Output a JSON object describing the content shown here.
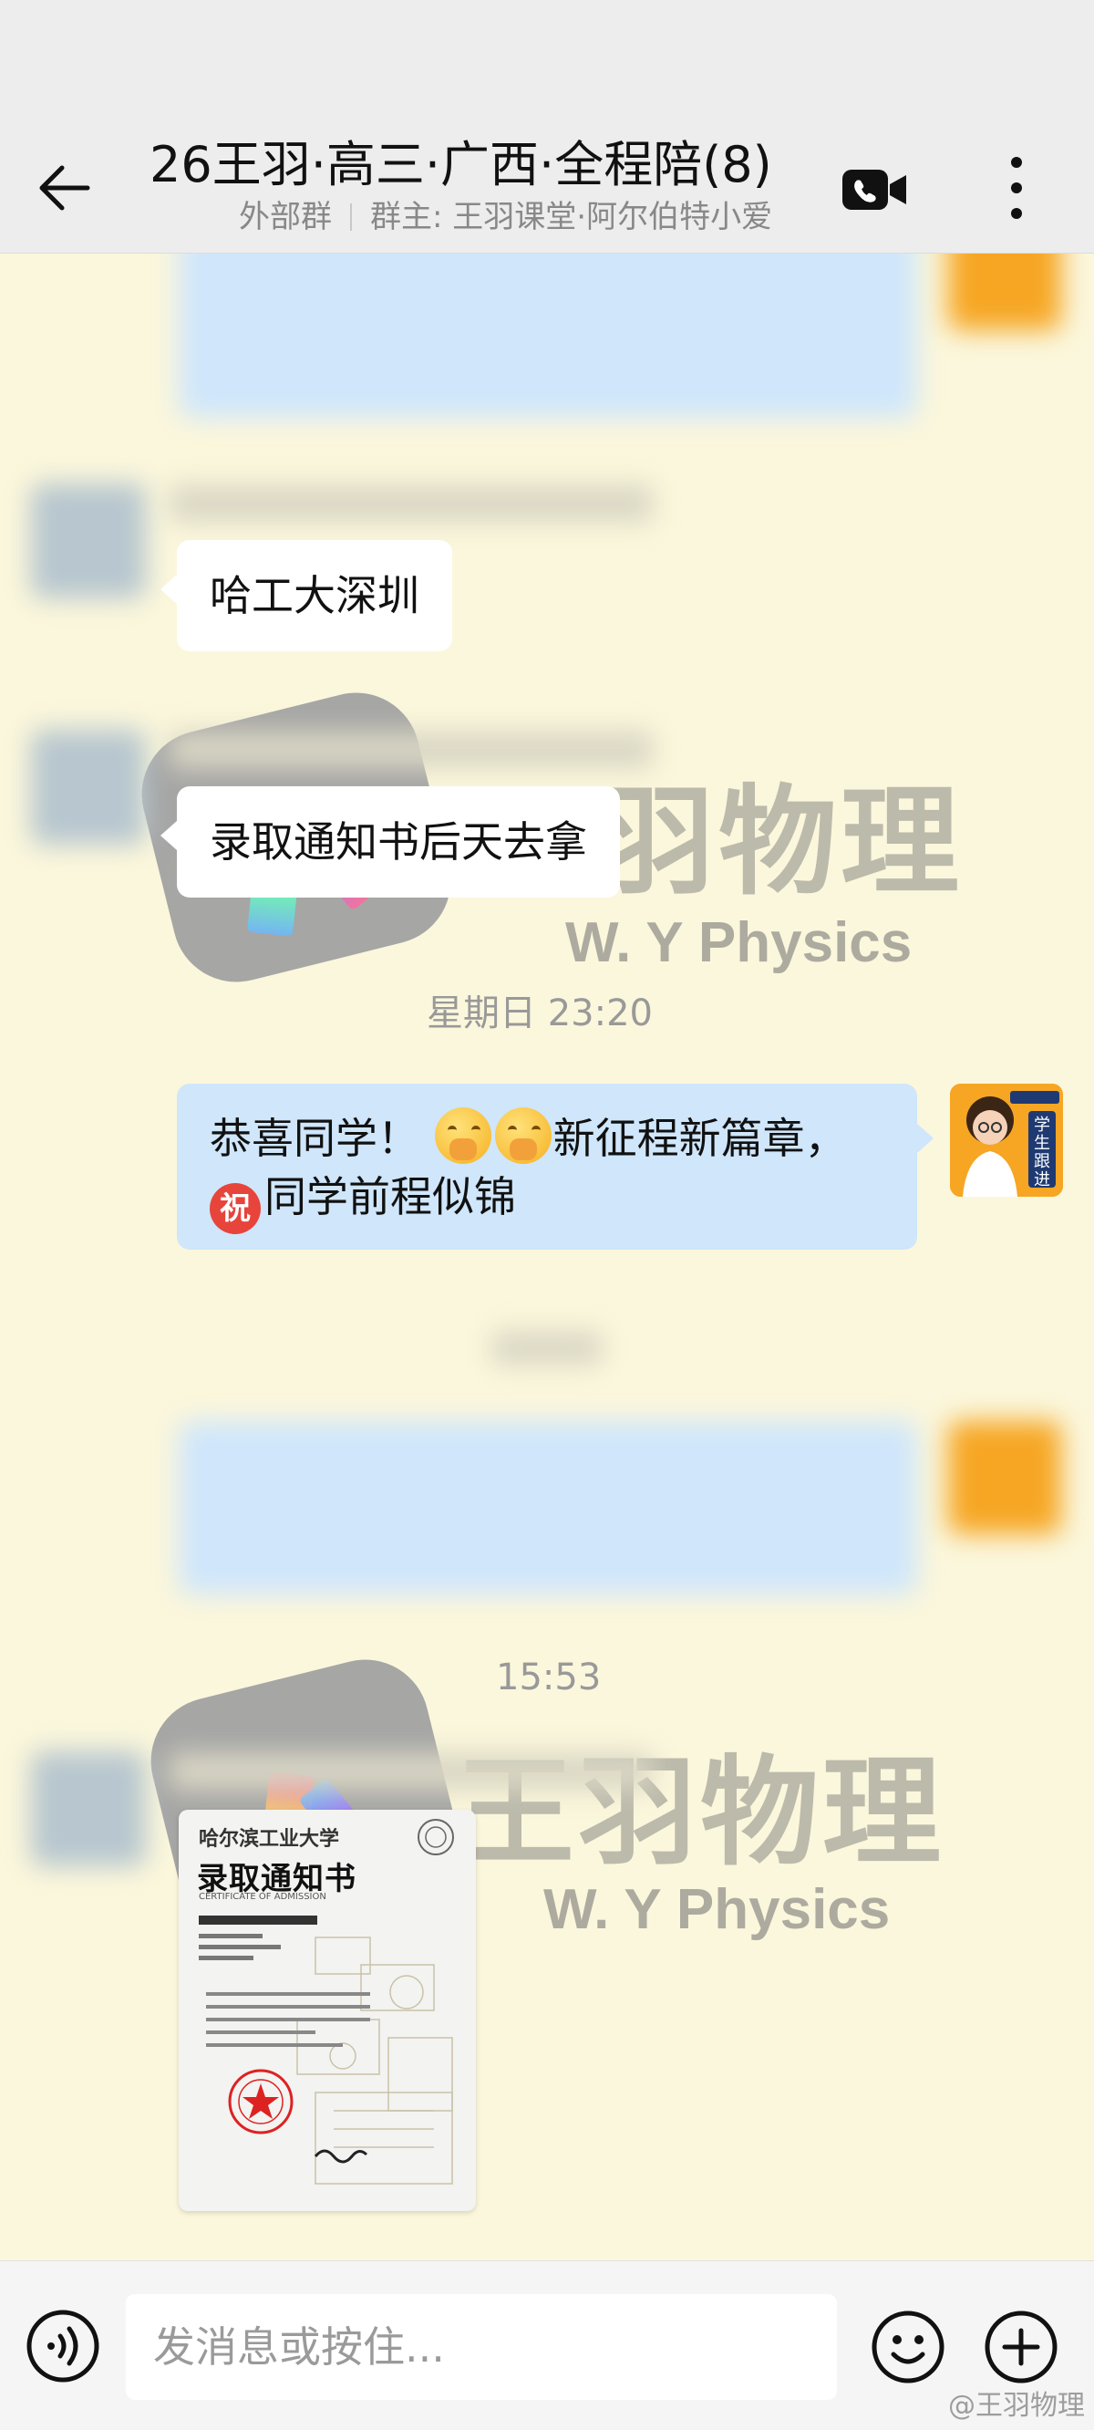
{
  "header": {
    "title": "26王羽·高三·广西·全程陪(8)",
    "group_type": "外部群",
    "owner": "群主: 王羽课堂·阿尔伯特小爱",
    "icons": [
      "back-arrow-icon",
      "video-call-icon",
      "more-icon"
    ]
  },
  "messages": [
    {
      "type": "text",
      "side": "left",
      "text": "哈工大深圳"
    },
    {
      "type": "text",
      "side": "left",
      "text": "录取通知书后天去拿"
    },
    {
      "type": "time",
      "text": "星期日  23:20"
    },
    {
      "type": "text",
      "side": "right",
      "line1_a": "恭喜同学！",
      "line1_b": "新征程新篇章，",
      "emoji": "shy-face-emoji",
      "badge": "祝",
      "line2": "同学前程似锦"
    },
    {
      "type": "time",
      "text": "15:53"
    },
    {
      "type": "image",
      "side": "left",
      "letter_title": "录取通知书",
      "letter_school": "哈尔滨工业大学",
      "letter_subtitle": "CERTIFICATE OF ADMISSION"
    }
  ],
  "my_avatar": {
    "label": "学生跟进",
    "brand": "王羽物理"
  },
  "watermark": {
    "cn": "王羽物理",
    "en": "W. Y  Physics"
  },
  "input": {
    "placeholder": "发消息或按住..."
  },
  "footer_watermark": "@王羽物理",
  "colors": {
    "bg": "#fbf7dc",
    "header": "#ededed",
    "bubble_white": "#ffffff",
    "bubble_blue": "#cfe6fb",
    "accent_orange": "#f6a623"
  }
}
